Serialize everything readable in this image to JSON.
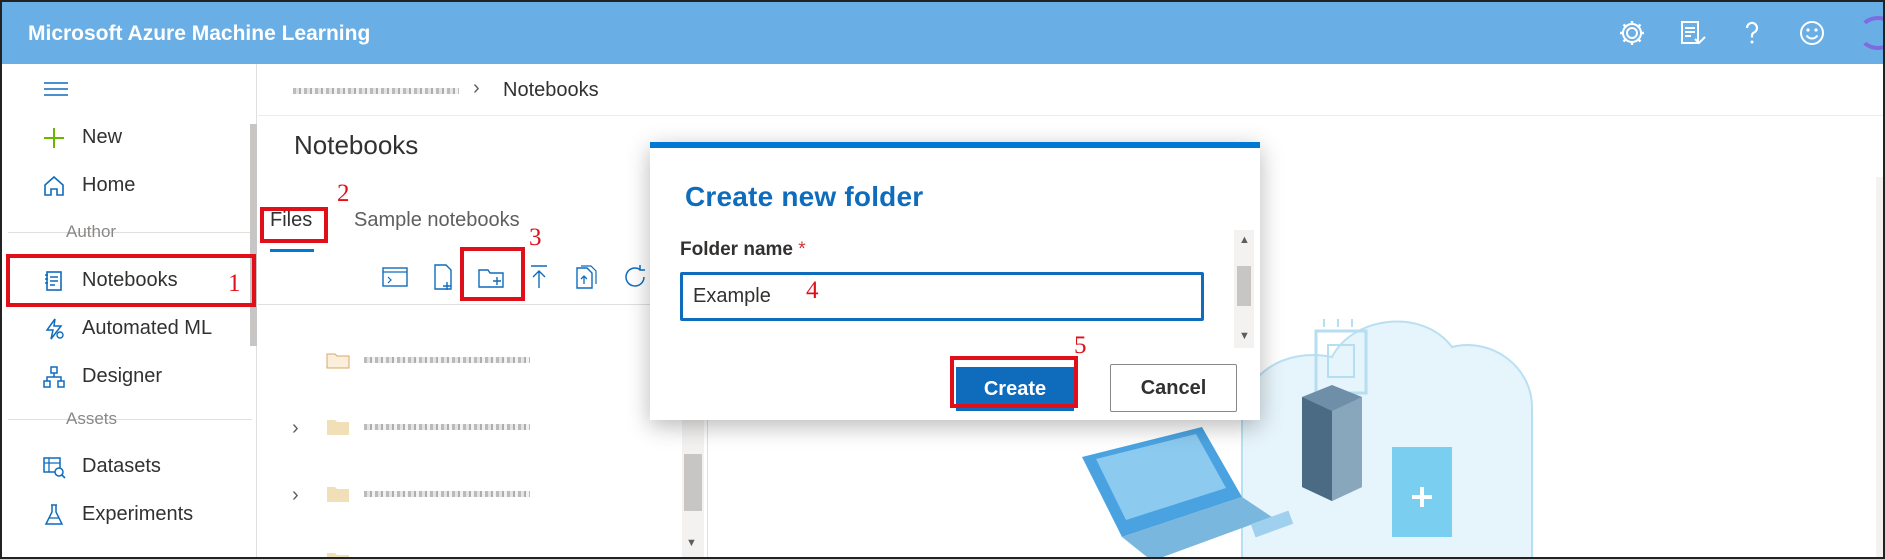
{
  "app": {
    "title": "Microsoft Azure Machine Learning"
  },
  "topbar": {
    "icons": [
      "gear-icon",
      "feedback-icon",
      "help-icon",
      "smiley-icon"
    ]
  },
  "sidebar": {
    "items": [
      {
        "label": "New",
        "icon": "plus-icon"
      },
      {
        "label": "Home",
        "icon": "home-icon"
      },
      {
        "label": "Notebooks",
        "icon": "notebook-icon"
      },
      {
        "label": "Automated ML",
        "icon": "automated-ml-icon"
      },
      {
        "label": "Designer",
        "icon": "designer-icon"
      },
      {
        "label": "Datasets",
        "icon": "datasets-icon"
      },
      {
        "label": "Experiments",
        "icon": "flask-icon"
      }
    ],
    "sections": {
      "author": "Author",
      "assets": "Assets"
    }
  },
  "breadcrumb": {
    "current": "Notebooks"
  },
  "notebooks": {
    "title": "Notebooks",
    "tabs": [
      "Files",
      "Sample notebooks"
    ],
    "toolbar": [
      "terminal-icon",
      "new-file-icon",
      "new-folder-icon",
      "upload-icon",
      "upload-folder-icon",
      "refresh-icon"
    ]
  },
  "dialog": {
    "title": "Create new folder",
    "field_label": "Folder name",
    "required_marker": "*",
    "input_value": "Example",
    "create_label": "Create",
    "cancel_label": "Cancel"
  },
  "annotations": [
    "1",
    "2",
    "3",
    "4",
    "5"
  ],
  "colors": {
    "topbar": "#6aaee6",
    "accent": "#0f6cbd",
    "marker": "#e0101b"
  }
}
